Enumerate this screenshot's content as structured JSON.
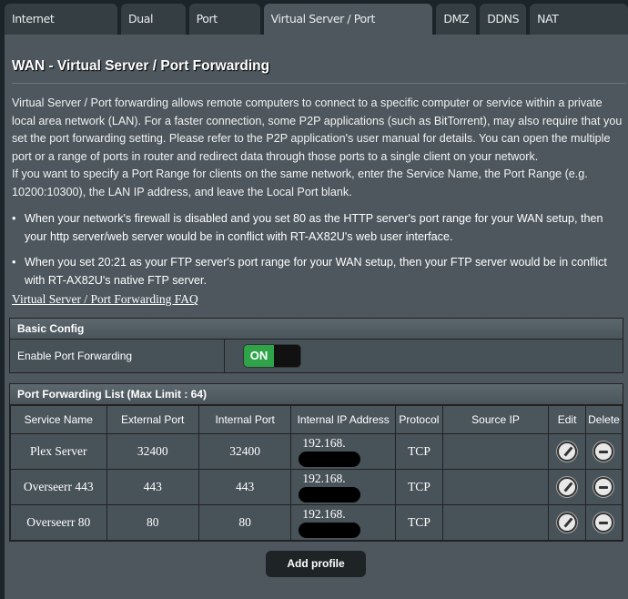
{
  "tabs": [
    "Internet Connection",
    "Dual WAN",
    "Port Trigger",
    "Virtual Server / Port Forwarding",
    "DMZ",
    "DDNS",
    "NAT Passthrough"
  ],
  "title": "WAN - Virtual Server / Port Forwarding",
  "description": [
    "Virtual Server / Port forwarding allows remote computers to connect to a specific computer or service within a private local area network (LAN). For a faster connection, some P2P applications (such as BitTorrent), may also require that you set the port forwarding setting. Please refer to the P2P application's user manual for details. You can open the multiple port or a range of ports in router and redirect data through those ports to a single client on your network.",
    "If you want to specify a Port Range for clients on the same network, enter the Service Name, the Port Range (e.g. 10200:10300), the LAN IP address, and leave the Local Port blank."
  ],
  "bullets": [
    "When your network's firewall is disabled and you set 80 as the HTTP server's port range for your WAN setup, then your http server/web server would be in conflict with RT-AX82U's web user interface.",
    "When you set 20:21 as your FTP server's port range for your WAN setup, then your FTP server would be in conflict with RT-AX82U's native FTP server."
  ],
  "faq_link": "Virtual Server / Port Forwarding FAQ",
  "basic_config": {
    "header": "Basic Config",
    "enable_label": "Enable Port Forwarding",
    "toggle": "ON"
  },
  "list": {
    "header": "Port Forwarding List (Max Limit : 64)",
    "columns": [
      "Service Name",
      "External Port",
      "Internal Port",
      "Internal IP Address",
      "Protocol",
      "Source IP",
      "Edit",
      "Delete"
    ],
    "rows": [
      {
        "name": "Plex Server",
        "ext": "32400",
        "int": "32400",
        "ip": "192.168.",
        "proto": "TCP",
        "src": ""
      },
      {
        "name": "Overseerr 443",
        "ext": "443",
        "int": "443",
        "ip": "192.168.",
        "proto": "TCP",
        "src": ""
      },
      {
        "name": "Overseerr 80",
        "ext": "80",
        "int": "80",
        "ip": "192.168.",
        "proto": "TCP",
        "src": ""
      }
    ]
  },
  "add_button": "Add profile"
}
